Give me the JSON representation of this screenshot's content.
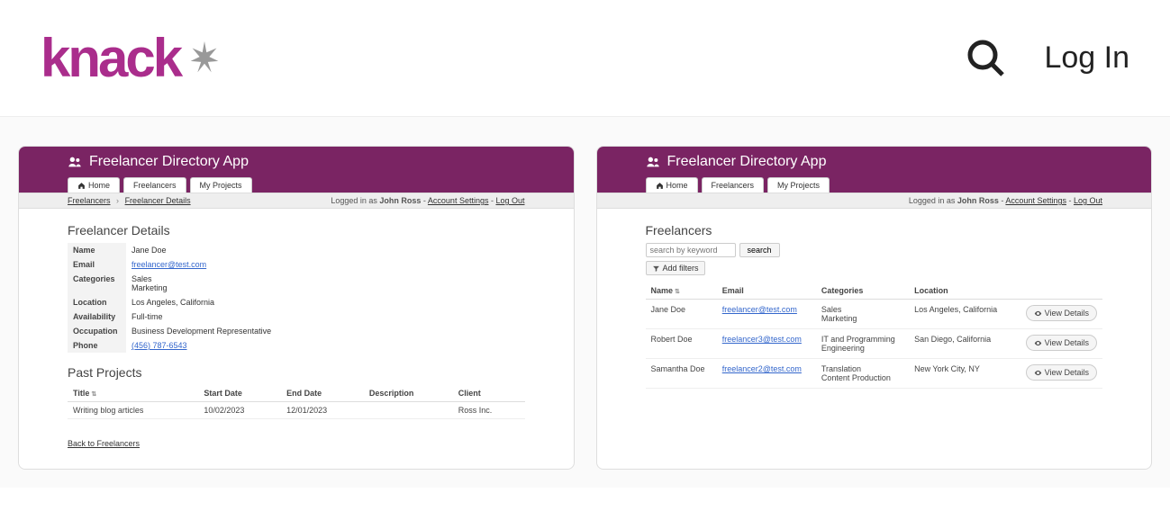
{
  "brand": "knack",
  "login": "Log In",
  "app": {
    "title": "Freelancer Directory App",
    "tabs": {
      "home": "Home",
      "freelancers": "Freelancers",
      "projects": "My Projects"
    },
    "logged_in_prefix": "Logged in as ",
    "user": "John Ross",
    "account_settings": "Account Settings",
    "log_out": "Log Out",
    "sep": " - "
  },
  "left": {
    "crumbs": {
      "a": "Freelancers",
      "b": "Freelancer Details"
    },
    "title": "Freelancer Details",
    "labels": {
      "name": "Name",
      "email": "Email",
      "categories": "Categories",
      "location": "Location",
      "availability": "Availability",
      "occupation": "Occupation",
      "phone": "Phone"
    },
    "values": {
      "name": "Jane Doe",
      "email": "freelancer@test.com",
      "cat1": "Sales",
      "cat2": "Marketing",
      "location": "Los Angeles, California",
      "availability": "Full-time",
      "occupation": "Business Development Representative",
      "phone": "(456) 787-6543"
    },
    "past_title": "Past Projects",
    "cols": {
      "title": "Title",
      "start": "Start Date",
      "end": "End Date",
      "desc": "Description",
      "client": "Client"
    },
    "row": {
      "title": "Writing blog articles",
      "start": "10/02/2023",
      "end": "12/01/2023",
      "desc": "",
      "client": "Ross Inc."
    },
    "back": "Back to Freelancers"
  },
  "right": {
    "title": "Freelancers",
    "search_placeholder": "search by keyword",
    "search_btn": "search",
    "add_filters": "Add filters",
    "cols": {
      "name": "Name",
      "email": "Email",
      "categories": "Categories",
      "location": "Location"
    },
    "view_btn": "View Details",
    "rows": [
      {
        "name": "Jane Doe",
        "email": "freelancer@test.com",
        "cat1": "Sales",
        "cat2": "Marketing",
        "location": "Los Angeles, California"
      },
      {
        "name": "Robert Doe",
        "email": "freelancer3@test.com",
        "cat1": "IT and Programming",
        "cat2": "Engineering",
        "location": "San Diego, California"
      },
      {
        "name": "Samantha Doe",
        "email": "freelancer2@test.com",
        "cat1": "Translation",
        "cat2": "Content Production",
        "location": "New York City, NY"
      }
    ]
  }
}
